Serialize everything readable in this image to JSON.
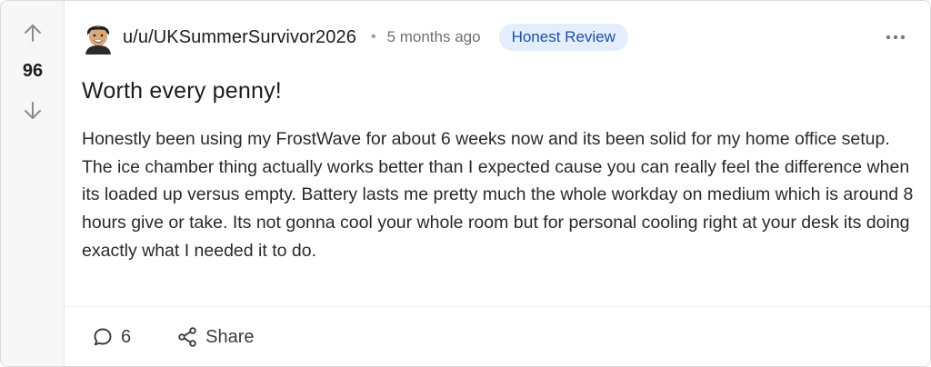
{
  "post": {
    "vote_count": "96",
    "username": "u/u/UKSummerSurvivor2026",
    "separator": "•",
    "timestamp": "5 months ago",
    "flair": "Honest Review",
    "title": "Worth every penny!",
    "body": "Honestly been using my FrostWave for about 6 weeks now and its been solid for my home office setup. The ice chamber thing actually works better than I expected cause you can really feel the difference when its loaded up versus empty. Battery lasts me pretty much the whole workday on medium which is around 8 hours give or take. Its not gonna cool your whole room but for personal cooling right at your desk its doing exactly what I needed it to do."
  },
  "footer": {
    "comment_count": "6",
    "share_label": "Share"
  },
  "icons": {
    "upvote": "arrow-up-icon",
    "downvote": "arrow-down-icon",
    "more": "more-horizontal-icon",
    "comment": "comment-icon",
    "share": "share-icon"
  },
  "colors": {
    "flair_bg": "#e3edfc",
    "flair_text": "#1d4fa3",
    "rail_bg": "#f7f7f8"
  }
}
